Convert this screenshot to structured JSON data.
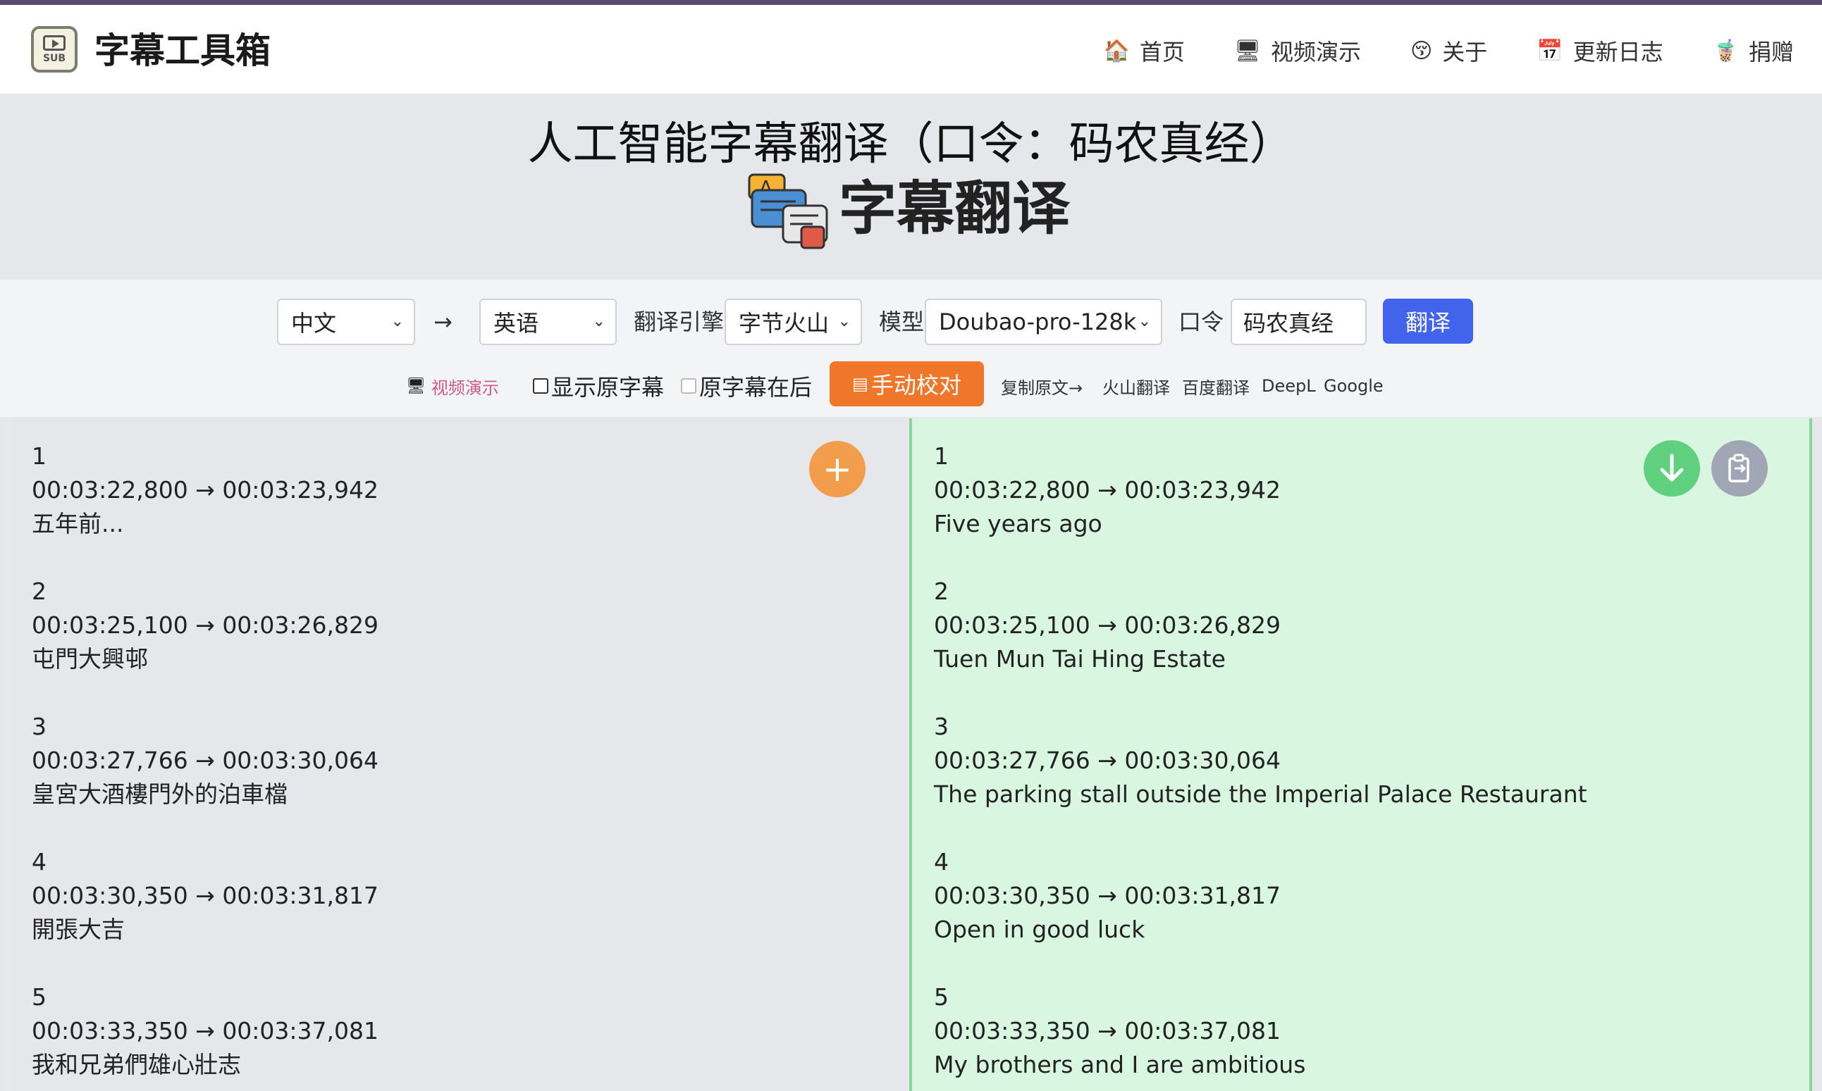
{
  "header": {
    "brand": "字幕工具箱",
    "logo_text": "SUB",
    "nav": [
      {
        "icon": "home-icon",
        "glyph": "🏠",
        "label": "首页"
      },
      {
        "icon": "monitor-icon",
        "glyph": "🖥",
        "label": "视频演示"
      },
      {
        "icon": "smiley-icon",
        "glyph": "😚",
        "label": "关于"
      },
      {
        "icon": "calendar-icon",
        "glyph": "📅",
        "label": "更新日志"
      },
      {
        "icon": "cup-icon",
        "glyph": "🧋",
        "label": "捐赠"
      }
    ]
  },
  "hero": {
    "title": "人工智能字幕翻译（口令：码农真经）",
    "subtitle": "字幕翻译"
  },
  "controls": {
    "source_lang": "中文",
    "arrow": "→",
    "target_lang": "英语",
    "engine_label": "翻译引擎",
    "engine": "字节火山",
    "model_label": "模型",
    "model": "Doubao-pro-128k",
    "password_label": "口令",
    "password_value": "码农真经",
    "translate_button": "翻译",
    "demo_link": "视频演示",
    "show_original": "显示原字幕",
    "original_after": "原字幕在后",
    "manual_button": "手动校对",
    "copy_original": "复制原文→",
    "links": [
      "火山翻译",
      "百度翻译",
      "DeepL",
      "Google"
    ]
  },
  "left_entries": [
    {
      "index": "1",
      "time": "00:03:22,800 → 00:03:23,942",
      "text": "五年前..."
    },
    {
      "index": "2",
      "time": "00:03:25,100 → 00:03:26,829",
      "text": "屯門大興邨"
    },
    {
      "index": "3",
      "time": "00:03:27,766 → 00:03:30,064",
      "text": "皇宮大酒樓門外的泊車檔"
    },
    {
      "index": "4",
      "time": "00:03:30,350 → 00:03:31,817",
      "text": "開張大吉"
    },
    {
      "index": "5",
      "time": "00:03:33,350 → 00:03:37,081",
      "text": "我和兄弟們雄心壯志"
    }
  ],
  "right_entries": [
    {
      "index": "1",
      "time": "00:03:22,800 → 00:03:23,942",
      "text": "Five years ago"
    },
    {
      "index": "2",
      "time": "00:03:25,100 → 00:03:26,829",
      "text": "Tuen Mun Tai Hing Estate"
    },
    {
      "index": "3",
      "time": "00:03:27,766 → 00:03:30,064",
      "text": "The parking stall outside the Imperial Palace Restaurant"
    },
    {
      "index": "4",
      "time": "00:03:30,350 → 00:03:31,817",
      "text": "Open in good luck"
    },
    {
      "index": "5",
      "time": "00:03:33,350 → 00:03:37,081",
      "text": "My brothers and I are ambitious"
    }
  ],
  "colors": {
    "translate_button": "#4263eb",
    "manual_button": "#f0772a",
    "add_button": "#f29d4b",
    "download_button": "#5fd07e",
    "copy_button": "#a0a6b3",
    "right_panel": "#d9f7e0"
  }
}
